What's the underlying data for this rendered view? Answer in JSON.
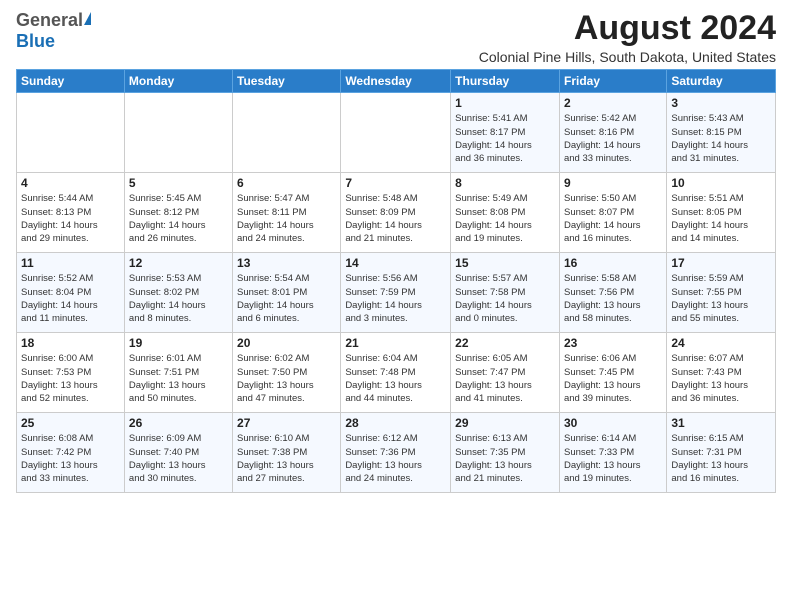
{
  "header": {
    "logo_general": "General",
    "logo_blue": "Blue",
    "title": "August 2024",
    "subtitle": "Colonial Pine Hills, South Dakota, United States"
  },
  "weekdays": [
    "Sunday",
    "Monday",
    "Tuesday",
    "Wednesday",
    "Thursday",
    "Friday",
    "Saturday"
  ],
  "weeks": [
    [
      {
        "day": "",
        "info": ""
      },
      {
        "day": "",
        "info": ""
      },
      {
        "day": "",
        "info": ""
      },
      {
        "day": "",
        "info": ""
      },
      {
        "day": "1",
        "info": "Sunrise: 5:41 AM\nSunset: 8:17 PM\nDaylight: 14 hours\nand 36 minutes."
      },
      {
        "day": "2",
        "info": "Sunrise: 5:42 AM\nSunset: 8:16 PM\nDaylight: 14 hours\nand 33 minutes."
      },
      {
        "day": "3",
        "info": "Sunrise: 5:43 AM\nSunset: 8:15 PM\nDaylight: 14 hours\nand 31 minutes."
      }
    ],
    [
      {
        "day": "4",
        "info": "Sunrise: 5:44 AM\nSunset: 8:13 PM\nDaylight: 14 hours\nand 29 minutes."
      },
      {
        "day": "5",
        "info": "Sunrise: 5:45 AM\nSunset: 8:12 PM\nDaylight: 14 hours\nand 26 minutes."
      },
      {
        "day": "6",
        "info": "Sunrise: 5:47 AM\nSunset: 8:11 PM\nDaylight: 14 hours\nand 24 minutes."
      },
      {
        "day": "7",
        "info": "Sunrise: 5:48 AM\nSunset: 8:09 PM\nDaylight: 14 hours\nand 21 minutes."
      },
      {
        "day": "8",
        "info": "Sunrise: 5:49 AM\nSunset: 8:08 PM\nDaylight: 14 hours\nand 19 minutes."
      },
      {
        "day": "9",
        "info": "Sunrise: 5:50 AM\nSunset: 8:07 PM\nDaylight: 14 hours\nand 16 minutes."
      },
      {
        "day": "10",
        "info": "Sunrise: 5:51 AM\nSunset: 8:05 PM\nDaylight: 14 hours\nand 14 minutes."
      }
    ],
    [
      {
        "day": "11",
        "info": "Sunrise: 5:52 AM\nSunset: 8:04 PM\nDaylight: 14 hours\nand 11 minutes."
      },
      {
        "day": "12",
        "info": "Sunrise: 5:53 AM\nSunset: 8:02 PM\nDaylight: 14 hours\nand 8 minutes."
      },
      {
        "day": "13",
        "info": "Sunrise: 5:54 AM\nSunset: 8:01 PM\nDaylight: 14 hours\nand 6 minutes."
      },
      {
        "day": "14",
        "info": "Sunrise: 5:56 AM\nSunset: 7:59 PM\nDaylight: 14 hours\nand 3 minutes."
      },
      {
        "day": "15",
        "info": "Sunrise: 5:57 AM\nSunset: 7:58 PM\nDaylight: 14 hours\nand 0 minutes."
      },
      {
        "day": "16",
        "info": "Sunrise: 5:58 AM\nSunset: 7:56 PM\nDaylight: 13 hours\nand 58 minutes."
      },
      {
        "day": "17",
        "info": "Sunrise: 5:59 AM\nSunset: 7:55 PM\nDaylight: 13 hours\nand 55 minutes."
      }
    ],
    [
      {
        "day": "18",
        "info": "Sunrise: 6:00 AM\nSunset: 7:53 PM\nDaylight: 13 hours\nand 52 minutes."
      },
      {
        "day": "19",
        "info": "Sunrise: 6:01 AM\nSunset: 7:51 PM\nDaylight: 13 hours\nand 50 minutes."
      },
      {
        "day": "20",
        "info": "Sunrise: 6:02 AM\nSunset: 7:50 PM\nDaylight: 13 hours\nand 47 minutes."
      },
      {
        "day": "21",
        "info": "Sunrise: 6:04 AM\nSunset: 7:48 PM\nDaylight: 13 hours\nand 44 minutes."
      },
      {
        "day": "22",
        "info": "Sunrise: 6:05 AM\nSunset: 7:47 PM\nDaylight: 13 hours\nand 41 minutes."
      },
      {
        "day": "23",
        "info": "Sunrise: 6:06 AM\nSunset: 7:45 PM\nDaylight: 13 hours\nand 39 minutes."
      },
      {
        "day": "24",
        "info": "Sunrise: 6:07 AM\nSunset: 7:43 PM\nDaylight: 13 hours\nand 36 minutes."
      }
    ],
    [
      {
        "day": "25",
        "info": "Sunrise: 6:08 AM\nSunset: 7:42 PM\nDaylight: 13 hours\nand 33 minutes."
      },
      {
        "day": "26",
        "info": "Sunrise: 6:09 AM\nSunset: 7:40 PM\nDaylight: 13 hours\nand 30 minutes."
      },
      {
        "day": "27",
        "info": "Sunrise: 6:10 AM\nSunset: 7:38 PM\nDaylight: 13 hours\nand 27 minutes."
      },
      {
        "day": "28",
        "info": "Sunrise: 6:12 AM\nSunset: 7:36 PM\nDaylight: 13 hours\nand 24 minutes."
      },
      {
        "day": "29",
        "info": "Sunrise: 6:13 AM\nSunset: 7:35 PM\nDaylight: 13 hours\nand 21 minutes."
      },
      {
        "day": "30",
        "info": "Sunrise: 6:14 AM\nSunset: 7:33 PM\nDaylight: 13 hours\nand 19 minutes."
      },
      {
        "day": "31",
        "info": "Sunrise: 6:15 AM\nSunset: 7:31 PM\nDaylight: 13 hours\nand 16 minutes."
      }
    ]
  ]
}
